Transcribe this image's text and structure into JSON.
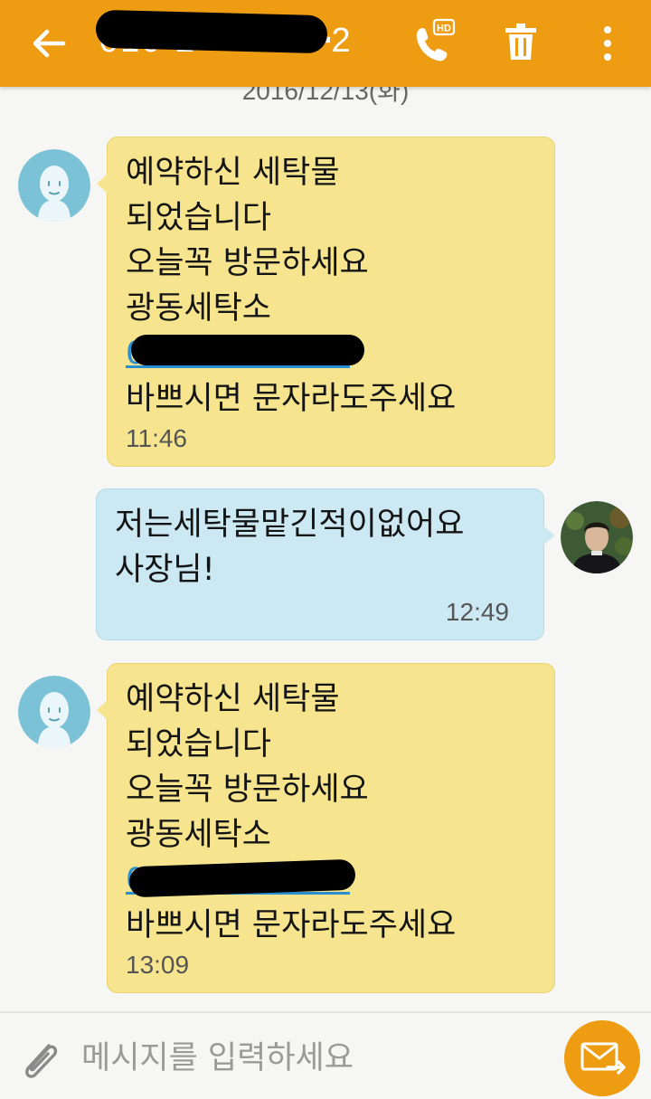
{
  "header": {
    "contact_title": "010-2━━━━━━2",
    "back_icon": "arrow-left-icon",
    "call_icon": "phone-hd-icon",
    "call_badge": "HD",
    "delete_icon": "trash-icon",
    "more_icon": "more-vertical-icon"
  },
  "date_divider": "2016/12/13(화)",
  "messages": [
    {
      "direction": "incoming",
      "lines": [
        "예약하신 세탁물",
        "되었습니다",
        "오늘꼭 방문하세요",
        "광동세탁소"
      ],
      "link": "038-048-1007",
      "line_after": "바쁘시면 문자라도주세요",
      "time": "11:46"
    },
    {
      "direction": "outgoing",
      "lines": [
        "저는세탁물맡긴적이없어요",
        "사장님!"
      ],
      "time": "12:49"
    },
    {
      "direction": "incoming",
      "lines": [
        "예약하신 세탁물",
        "되었습니다",
        "오늘꼭 방문하세요",
        "광동세탁소"
      ],
      "link": "038-048-1007",
      "line_after": "바쁘시면 문자라도주세요",
      "time": "13:09"
    }
  ],
  "composer": {
    "placeholder": "메시지를 입력하세요",
    "attach_icon": "paperclip-icon",
    "send_icon": "send-envelope-icon"
  },
  "colors": {
    "app_bar": "#ee9c12",
    "incoming_bubble": "#f6e58e",
    "outgoing_bubble": "#cbe8f3",
    "link": "#2a8fd0",
    "send_button": "#ee9c12"
  }
}
